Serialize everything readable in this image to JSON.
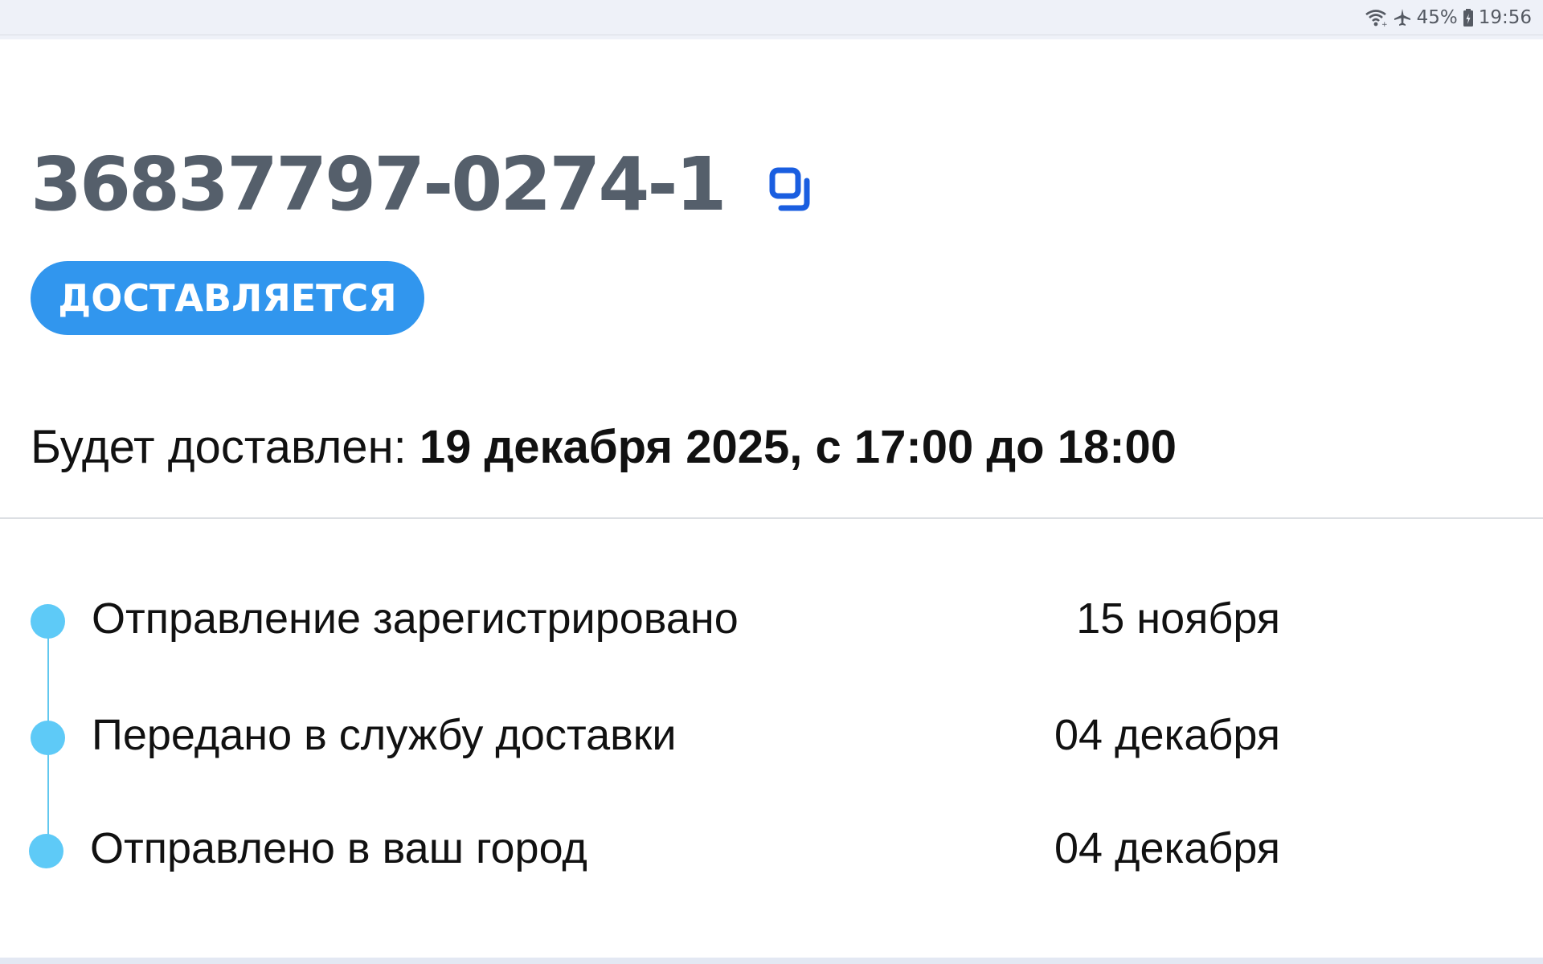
{
  "status_bar": {
    "battery": "45%",
    "time": "19:56",
    "icons": [
      "wifi-icon",
      "airplane-icon",
      "battery-icon"
    ]
  },
  "order": {
    "number": "36837797-0274-1",
    "copy_icon": "copy-icon",
    "status_badge": "ДОСТАВЛЯЕТСЯ",
    "delivery_prefix": "Будет доставлен: ",
    "delivery_value": "19 декабря 2025, с 17:00 до 18:00"
  },
  "timeline": [
    {
      "label": "Отправление зарегистрировано",
      "date": "15 ноября"
    },
    {
      "label": "Передано в службу доставки",
      "date": "04 декабря"
    },
    {
      "label": "Отправлено в ваш город",
      "date": "04 декабря"
    }
  ],
  "colors": {
    "accent_blue": "#3196ee",
    "copy_icon_blue": "#1a5ee0",
    "timeline_dot": "#5ecaf7",
    "order_number_gray": "#555f6b"
  }
}
